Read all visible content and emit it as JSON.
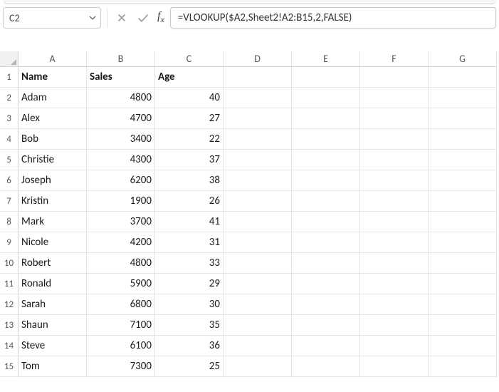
{
  "name_box": {
    "value": "C2"
  },
  "formula_bar": {
    "formula": "=VLOOKUP($A2,Sheet2!A2:B15,2,FALSE)"
  },
  "columns": [
    "A",
    "B",
    "C",
    "D",
    "E",
    "F",
    "G"
  ],
  "rows": [
    "1",
    "2",
    "3",
    "4",
    "5",
    "6",
    "7",
    "8",
    "9",
    "10",
    "11",
    "12",
    "13",
    "14",
    "15"
  ],
  "chart_data": {
    "type": "table",
    "headers": [
      "Name",
      "Sales",
      "Age"
    ],
    "records": [
      {
        "name": "Adam",
        "sales": 4800,
        "age": 40
      },
      {
        "name": "Alex",
        "sales": 4700,
        "age": 27
      },
      {
        "name": "Bob",
        "sales": 3400,
        "age": 22
      },
      {
        "name": "Christie",
        "sales": 4300,
        "age": 37
      },
      {
        "name": "Joseph",
        "sales": 6200,
        "age": 38
      },
      {
        "name": "Kristin",
        "sales": 1900,
        "age": 26
      },
      {
        "name": "Mark",
        "sales": 3700,
        "age": 41
      },
      {
        "name": "Nicole",
        "sales": 4200,
        "age": 31
      },
      {
        "name": "Robert",
        "sales": 4800,
        "age": 33
      },
      {
        "name": "Ronald",
        "sales": 5900,
        "age": 29
      },
      {
        "name": "Sarah",
        "sales": 6800,
        "age": 30
      },
      {
        "name": "Shaun",
        "sales": 7100,
        "age": 35
      },
      {
        "name": "Steve",
        "sales": 6100,
        "age": 36
      },
      {
        "name": "Tom",
        "sales": 7300,
        "age": 25
      }
    ]
  }
}
